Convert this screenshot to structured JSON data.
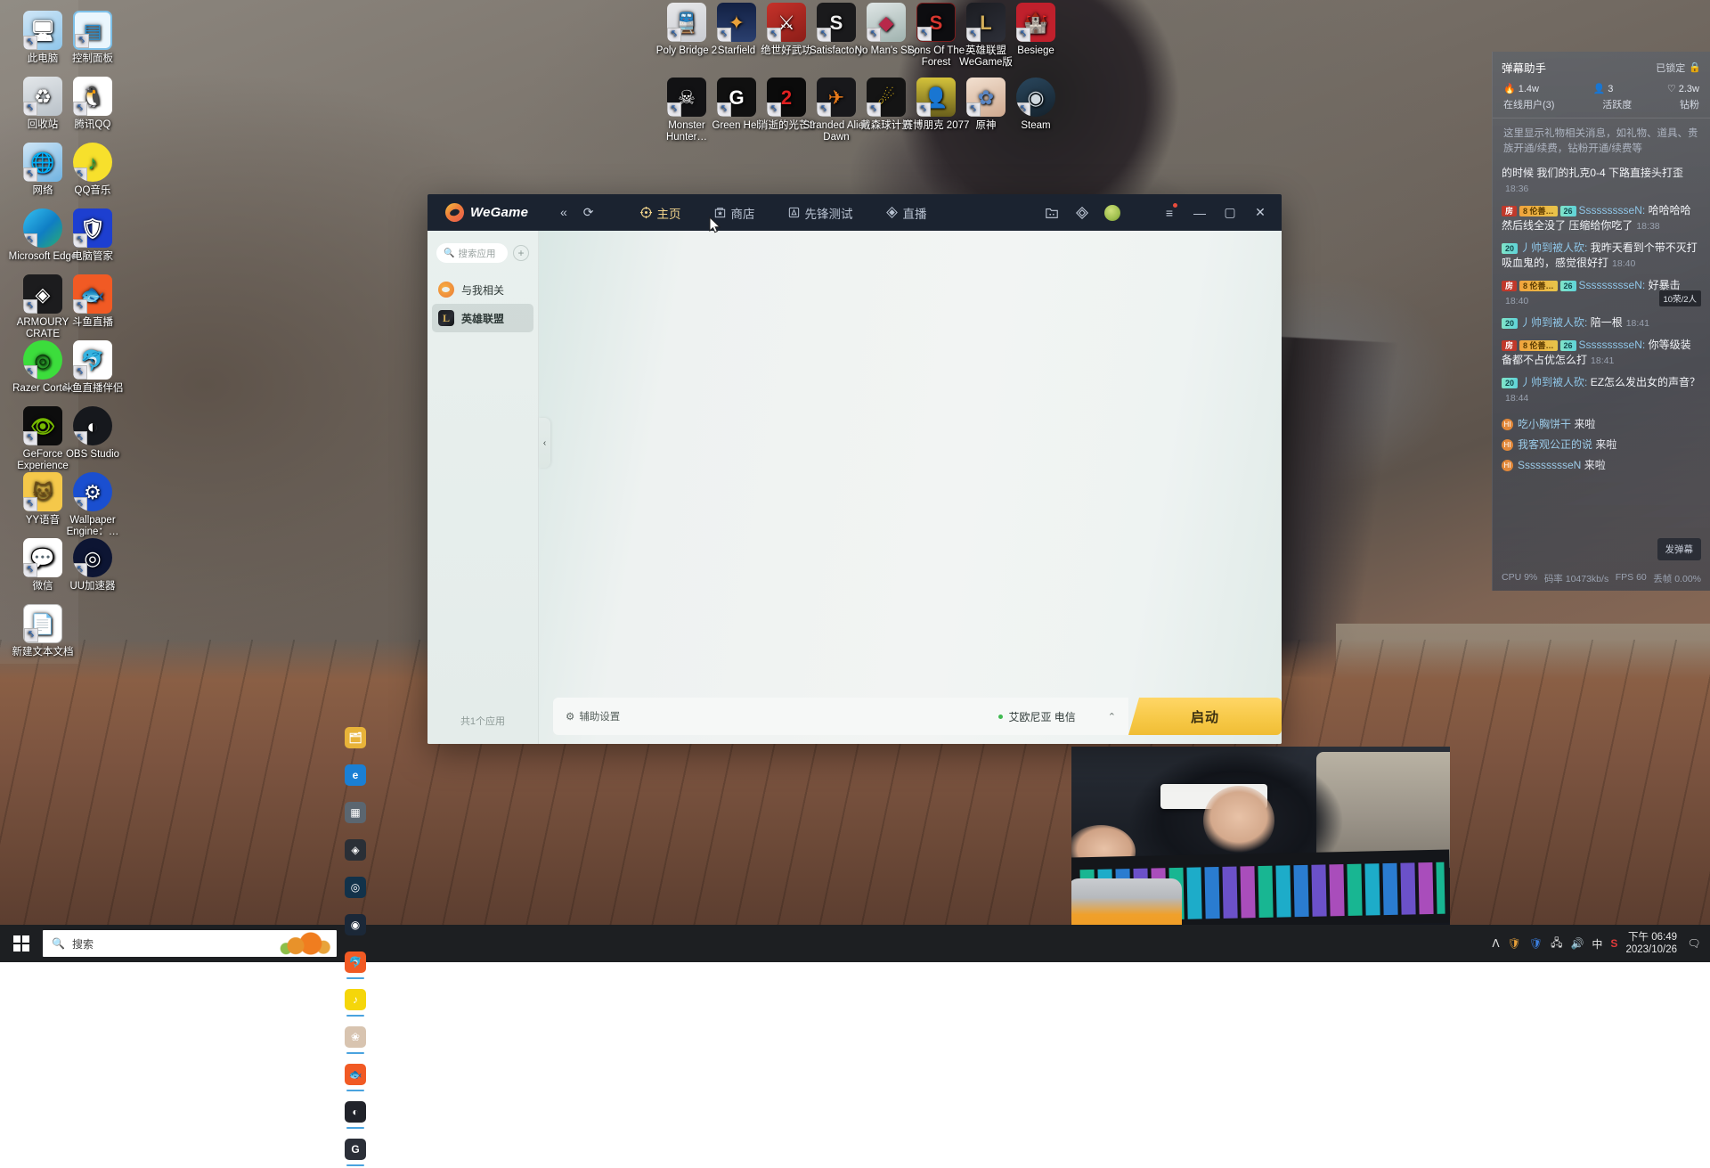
{
  "desktop": {
    "left_icons": [
      {
        "label": "此电脑",
        "icon": "this-pc-icon"
      },
      {
        "label": "控制面板",
        "icon": "control-panel-icon"
      },
      {
        "label": "回收站",
        "icon": "recycle-bin-icon"
      },
      {
        "label": "腾讯QQ",
        "icon": "tencent-qq-icon"
      },
      {
        "label": "网络",
        "icon": "network-icon"
      },
      {
        "label": "QQ音乐",
        "icon": "qq-music-icon"
      },
      {
        "label": "Microsoft Edge",
        "icon": "microsoft-edge-icon"
      },
      {
        "label": "电脑管家",
        "icon": "pc-manager-icon"
      },
      {
        "label": "ARMOURY CRATE",
        "icon": "armoury-crate-icon"
      },
      {
        "label": "斗鱼直播",
        "icon": "douyu-live-icon"
      },
      {
        "label": "Razer Cortex",
        "icon": "razer-cortex-icon"
      },
      {
        "label": "斗鱼直播伴侣",
        "icon": "douyu-companion-icon"
      },
      {
        "label": "GeForce Experience",
        "icon": "geforce-experience-icon"
      },
      {
        "label": "OBS Studio",
        "icon": "obs-studio-icon"
      },
      {
        "label": "YY语音",
        "icon": "yy-voice-icon"
      },
      {
        "label": "Wallpaper Engine：…",
        "icon": "wallpaper-engine-icon"
      },
      {
        "label": "微信",
        "icon": "wechat-icon"
      },
      {
        "label": "UU加速器",
        "icon": "uu-booster-icon"
      },
      {
        "label": "新建文本文档",
        "icon": "text-document-icon"
      }
    ],
    "game_icons": [
      {
        "label": "Poly Bridge 2",
        "icon": "poly-bridge-2-icon"
      },
      {
        "label": "Starfield",
        "icon": "starfield-icon"
      },
      {
        "label": "绝世好武功",
        "icon": "wushu-game-icon"
      },
      {
        "label": "Satisfactory",
        "icon": "satisfactory-icon"
      },
      {
        "label": "No Man's Sky",
        "icon": "no-mans-sky-icon"
      },
      {
        "label": "Sons Of The Forest",
        "icon": "sons-of-the-forest-icon"
      },
      {
        "label": "英雄联盟 WeGame版",
        "icon": "lol-wegame-icon"
      },
      {
        "label": "Besiege",
        "icon": "besiege-icon"
      },
      {
        "label": "Monster Hunter…",
        "icon": "monster-hunter-icon"
      },
      {
        "label": "Green Hell",
        "icon": "green-hell-icon"
      },
      {
        "label": "消逝的光芒2",
        "icon": "dying-light-2-icon"
      },
      {
        "label": "Stranded Alien Dawn",
        "icon": "stranded-alien-dawn-icon"
      },
      {
        "label": "戴森球计划",
        "icon": "dyson-sphere-program-icon"
      },
      {
        "label": "赛博朋克 2077",
        "icon": "cyberpunk-2077-icon"
      },
      {
        "label": "原神",
        "icon": "genshin-impact-icon"
      },
      {
        "label": "Steam",
        "icon": "steam-icon"
      }
    ]
  },
  "wegame": {
    "brand": "WeGame",
    "nav": {
      "back": "«",
      "refresh": "⟳"
    },
    "tabs": [
      {
        "label": "主页",
        "icon": "home-target-icon",
        "active": true
      },
      {
        "label": "商店",
        "icon": "store-bag-icon",
        "active": false
      },
      {
        "label": "先锋测试",
        "icon": "beta-test-icon",
        "active": false
      },
      {
        "label": "直播",
        "icon": "live-diamond-icon",
        "active": false
      }
    ],
    "right_icons": [
      {
        "name": "library-icon",
        "glyph": "🗔"
      },
      {
        "name": "diamond-icon",
        "glyph": "◈"
      },
      {
        "name": "user-avatar",
        "glyph": ""
      }
    ],
    "window_controls": {
      "menu": "≡",
      "minimize": "—",
      "maximize": "▢",
      "close": "✕"
    },
    "sidebar": {
      "search_placeholder": "搜索应用",
      "add_label": "+",
      "items": [
        {
          "label": "与我相关",
          "icon": "related-to-me-icon",
          "selected": false
        },
        {
          "label": "英雄联盟",
          "icon": "league-of-legends-icon",
          "selected": true
        }
      ],
      "count_text": "共1个应用"
    },
    "collapse_handle": "‹",
    "bottom_bar": {
      "aux_label": "辅助设置",
      "aux_icon": "gear-icon",
      "server": "艾欧尼亚 电信",
      "server_status_color": "#3fb950",
      "expand_icon": "chevron-up-icon",
      "launch_label": "启动"
    }
  },
  "danmaku": {
    "title": "弹幕助手",
    "lock_label": "已锁定",
    "lock_icon": "lock-icon",
    "stats": [
      {
        "icon": "fire-icon",
        "value": "1.4w"
      },
      {
        "icon": "user-icon",
        "value": "3"
      },
      {
        "icon": "heart-icon",
        "value": "2.3w"
      }
    ],
    "stat_labels": [
      "在线用户(3)",
      "活跃度",
      "钻粉"
    ],
    "notice": "这里显示礼物相关消息，如礼物、道具、贵族开通/续费，钻粉开通/续费等",
    "gift_pill": "10荣/2人",
    "messages": [
      {
        "badges": [],
        "name": "",
        "text": "的时候 我们的扎克0-4 下路直接头打歪",
        "time": "18:36"
      },
      {
        "badges": [
          {
            "type": "room",
            "text": "房"
          },
          {
            "type": "lv",
            "text": "8 伦善…"
          },
          {
            "type": "fan",
            "text": "26"
          }
        ],
        "name": "SsssssssseN",
        "text": "哈哈哈哈然后线全没了 压缩给你吃了",
        "time": "18:38"
      },
      {
        "badges": [
          {
            "type": "fan",
            "text": "20"
          }
        ],
        "name": "丿帅到被人砍",
        "text": "我昨天看到个带不灭打吸血鬼的，感觉很好打",
        "time": "18:40"
      },
      {
        "badges": [
          {
            "type": "room",
            "text": "房"
          },
          {
            "type": "lv",
            "text": "8 伦善…"
          },
          {
            "type": "fan",
            "text": "26"
          }
        ],
        "name": "SsssssssseN",
        "text": "好暴击",
        "time": "18:40"
      },
      {
        "badges": [
          {
            "type": "fan",
            "text": "20"
          }
        ],
        "name": "丿帅到被人砍",
        "text": "陪一根",
        "time": "18:41"
      },
      {
        "badges": [
          {
            "type": "room",
            "text": "房"
          },
          {
            "type": "lv",
            "text": "8 伦善…"
          },
          {
            "type": "fan",
            "text": "26"
          }
        ],
        "name": "SsssssssseN",
        "text": "你等级装备都不占优怎么打",
        "time": "18:41"
      },
      {
        "badges": [
          {
            "type": "fan",
            "text": "20"
          }
        ],
        "name": "丿帅到被人砍",
        "text": "EZ怎么发出女的声音？",
        "time": "18:44"
      }
    ],
    "enters": [
      {
        "who": "吃小胸饼干",
        "action": "来啦"
      },
      {
        "who": "我客观公正的说",
        "action": "来啦"
      },
      {
        "who": "SsssssssseN",
        "action": "来啦"
      }
    ],
    "send_button": "发弹幕",
    "status": [
      {
        "label": "CPU",
        "value": "9%"
      },
      {
        "label": "码率",
        "value": "10473kb/s"
      },
      {
        "label": "FPS",
        "value": "60"
      },
      {
        "label": "丢帧",
        "value": "0.00%"
      }
    ]
  },
  "taskbar": {
    "start_icon": "windows-start-icon",
    "search_placeholder": "搜索",
    "apps": [
      {
        "name": "file-explorer-icon",
        "glyph": "🗂",
        "color": "#e8b339",
        "running": false
      },
      {
        "name": "microsoft-edge-icon",
        "glyph": "e",
        "color": "#1a7fd4",
        "running": false
      },
      {
        "name": "calculator-icon",
        "glyph": "▦",
        "color": "#5b6670",
        "running": false
      },
      {
        "name": "armoury-crate-icon",
        "glyph": "◈",
        "color": "#2a2f36",
        "running": false
      },
      {
        "name": "uu-booster-icon",
        "glyph": "◎",
        "color": "#12324a",
        "running": false
      },
      {
        "name": "steam-icon",
        "glyph": "◉",
        "color": "#1b2838",
        "running": false
      },
      {
        "name": "douyu-companion-icon",
        "glyph": "🐬",
        "color": "#f15a24",
        "running": true
      },
      {
        "name": "qq-music-icon",
        "glyph": "♪",
        "color": "#f5d60a",
        "running": true
      },
      {
        "name": "wallpaper-engine-icon",
        "glyph": "❀",
        "color": "#d8c4b0",
        "running": true
      },
      {
        "name": "douyu-live-icon",
        "glyph": "🐟",
        "color": "#f15a24",
        "running": true
      },
      {
        "name": "obs-studio-icon",
        "glyph": "◐",
        "color": "#21232a",
        "running": true
      },
      {
        "name": "wegame-icon",
        "glyph": "G",
        "color": "#2b2f38",
        "running": true,
        "active": true
      }
    ],
    "tray": [
      {
        "name": "show-hidden-icons",
        "glyph": "ᐱ"
      },
      {
        "name": "tencent-pc-manager-tray-icon",
        "glyph": "🛡"
      },
      {
        "name": "security-shield-icon",
        "glyph": "🛡"
      },
      {
        "name": "network-icon",
        "glyph": "🖧"
      },
      {
        "name": "volume-icon",
        "glyph": "🔊"
      },
      {
        "name": "ime-chinese-icon",
        "glyph": "中"
      },
      {
        "name": "sogou-input-icon",
        "glyph": "S"
      }
    ],
    "clock": {
      "time": "下午 06:49",
      "date": "2023/10/26"
    },
    "action_center_icon": "action-center-icon"
  }
}
